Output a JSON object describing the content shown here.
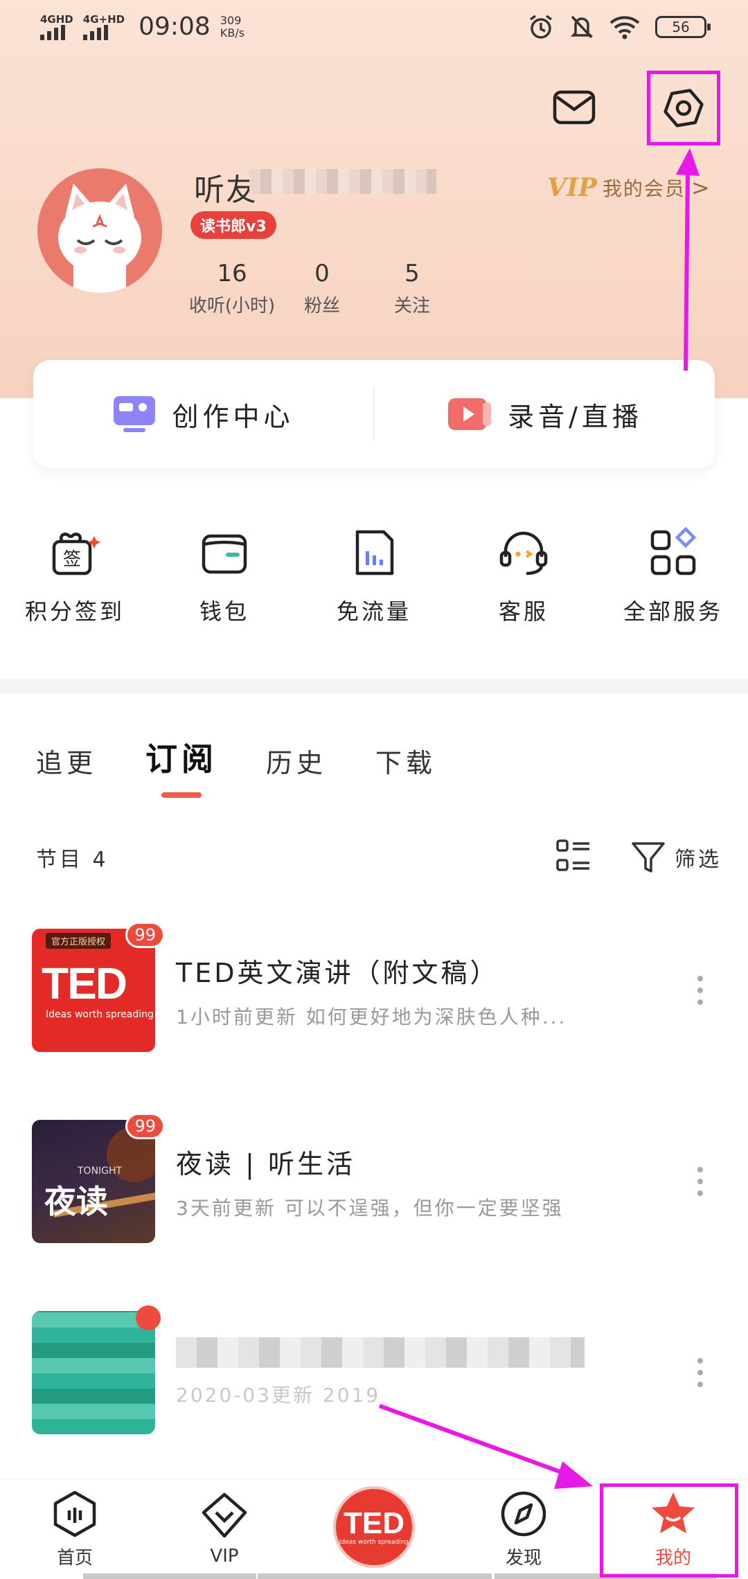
{
  "status_bar": {
    "network1": "4GHD",
    "network2": "4G+HD",
    "time": "09:08",
    "speed_value": "309",
    "speed_unit": "KB/s",
    "battery": "56"
  },
  "profile": {
    "username": "听友",
    "level_badge": "读书郎v3",
    "vip_logo": "VIP",
    "vip_text": "我的会员",
    "vip_arrow": ">",
    "stats": [
      {
        "value": "16",
        "label": "收听(小时)"
      },
      {
        "value": "0",
        "label": "粉丝"
      },
      {
        "value": "5",
        "label": "关注"
      }
    ]
  },
  "creator": {
    "left_label": "创作中心",
    "right_label": "录音/直播"
  },
  "services": [
    {
      "label": "积分签到",
      "icon": "checkin-gift-icon"
    },
    {
      "label": "钱包",
      "icon": "wallet-icon"
    },
    {
      "label": "免流量",
      "icon": "data-free-icon"
    },
    {
      "label": "客服",
      "icon": "customer-service-icon"
    },
    {
      "label": "全部服务",
      "icon": "all-services-icon"
    }
  ],
  "tabs": [
    {
      "label": "追更",
      "active": false
    },
    {
      "label": "订阅",
      "active": true
    },
    {
      "label": "历史",
      "active": false
    },
    {
      "label": "下载",
      "active": false
    }
  ],
  "list_header": {
    "count_label": "节目 4",
    "filter_label": "筛选"
  },
  "list": [
    {
      "title": "TED英文演讲（附文稿）",
      "subtitle": "1小时前更新   如何更好地为深肤色人种...",
      "badge": "99",
      "cover_tag": "官方正版授权",
      "cover_main": "TED",
      "cover_sub": "Ideas worth spreading"
    },
    {
      "title": "夜读 | 听生活",
      "subtitle": "3天前更新   可以不逞强，但你一定要坚强",
      "badge": "99",
      "cover_main": "夜读",
      "cover_sub": "TONIGHT"
    },
    {
      "title": "",
      "subtitle": "2020-03更新   2019"
    }
  ],
  "bottom_nav": [
    {
      "label": "首页",
      "icon": "home-icon"
    },
    {
      "label": "VIP",
      "icon": "vip-icon"
    },
    {
      "label": "",
      "icon": "ted-center-icon"
    },
    {
      "label": "发现",
      "icon": "discover-icon"
    },
    {
      "label": "我的",
      "icon": "mine-icon"
    }
  ],
  "bottom_center": {
    "main": "TED",
    "sub": "Ideas worth spreading"
  },
  "colors": {
    "accent": "#ef4b3c",
    "annotation": "#e619e6",
    "vip_gold": "#e3a043"
  }
}
